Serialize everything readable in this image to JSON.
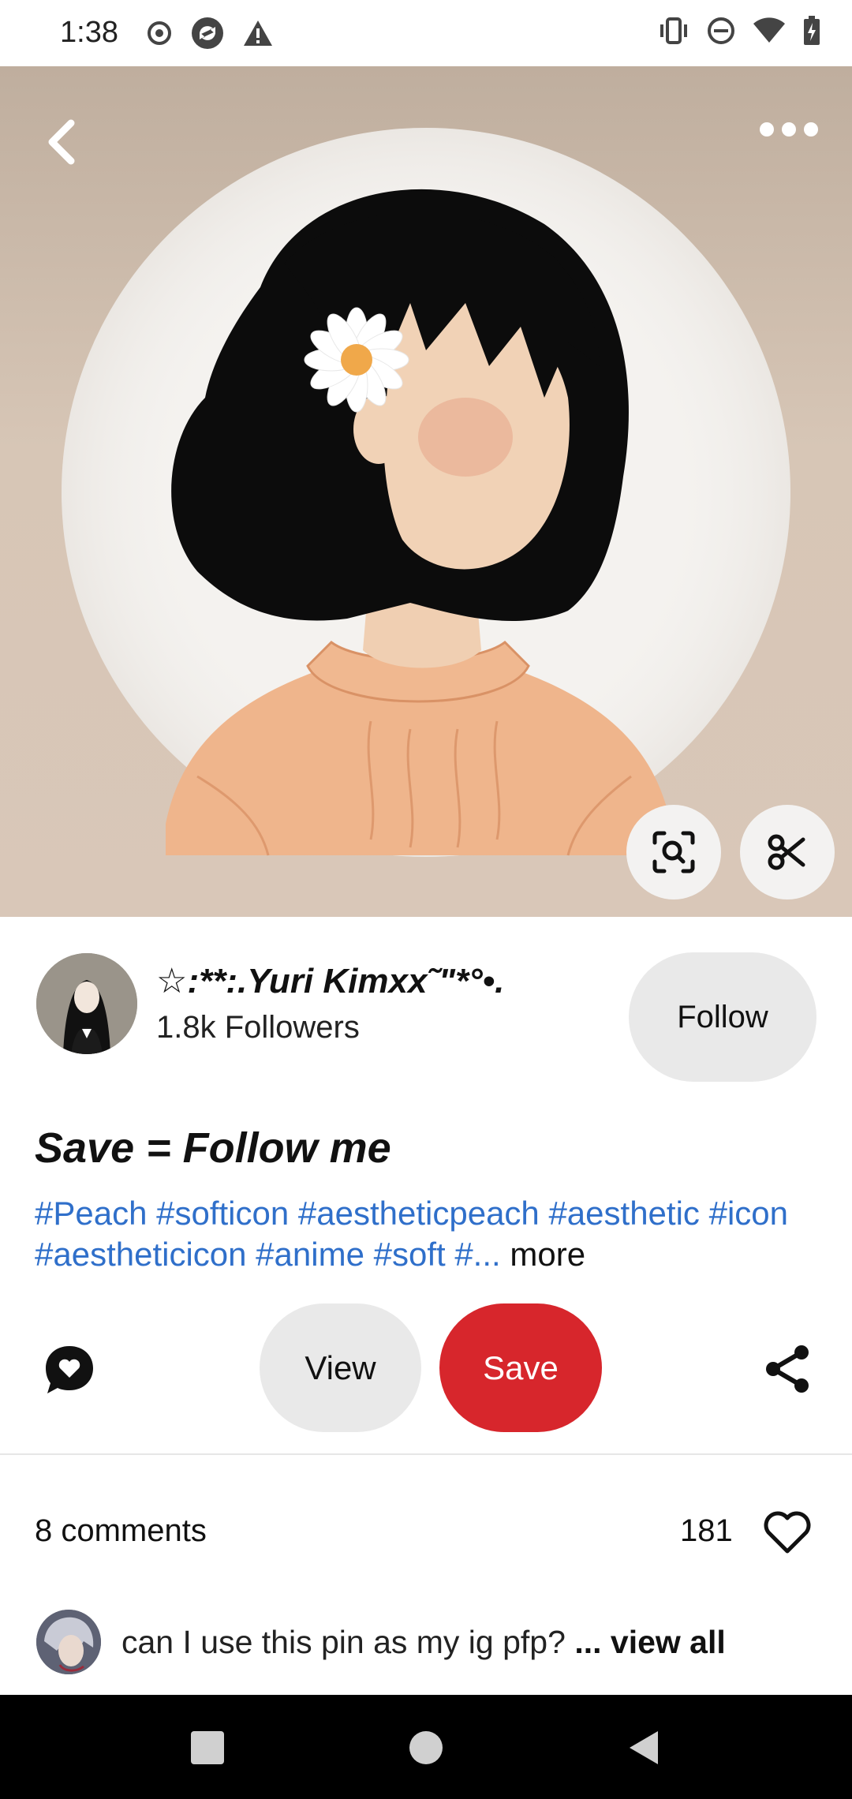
{
  "status_bar": {
    "time": "1:38",
    "left_icons": [
      "record-icon",
      "sync-icon",
      "warning-icon"
    ],
    "right_icons": [
      "vibrate-icon",
      "dnd-icon",
      "wifi-icon",
      "battery-icon"
    ]
  },
  "top_bar": {
    "back_icon": "chevron-left-icon",
    "menu_icon": "more-horizontal-icon"
  },
  "image_tools": {
    "lens_icon": "visual-search-icon",
    "cutout_icon": "scissors-icon"
  },
  "author": {
    "name": "☆:**:.Yuri Kimxx˜\"*°•.",
    "followers": "1.8k Followers",
    "follow_label": "Follow"
  },
  "pin": {
    "title": "Save = Follow me",
    "tags_text": "#Peach #softicon #aestheticpeach #aesthetic #icon #aestheticicon #anime #soft #...",
    "more_label": "more"
  },
  "actions": {
    "comment_icon": "comment-heart-icon",
    "view_label": "View",
    "save_label": "Save",
    "share_icon": "share-icon"
  },
  "comments": {
    "count_label": "8 comments",
    "likes": "181",
    "like_icon": "heart-outline-icon",
    "preview_text": "can I use this pin as my ig pfp?",
    "view_all_label": "... view all"
  },
  "colors": {
    "save_red": "#d7262c",
    "tag_blue": "#2f6fca",
    "pill_gray": "#e9e9e9"
  },
  "nav_bar": {
    "buttons": [
      "recents-square-icon",
      "home-circle-icon",
      "back-triangle-icon"
    ]
  }
}
